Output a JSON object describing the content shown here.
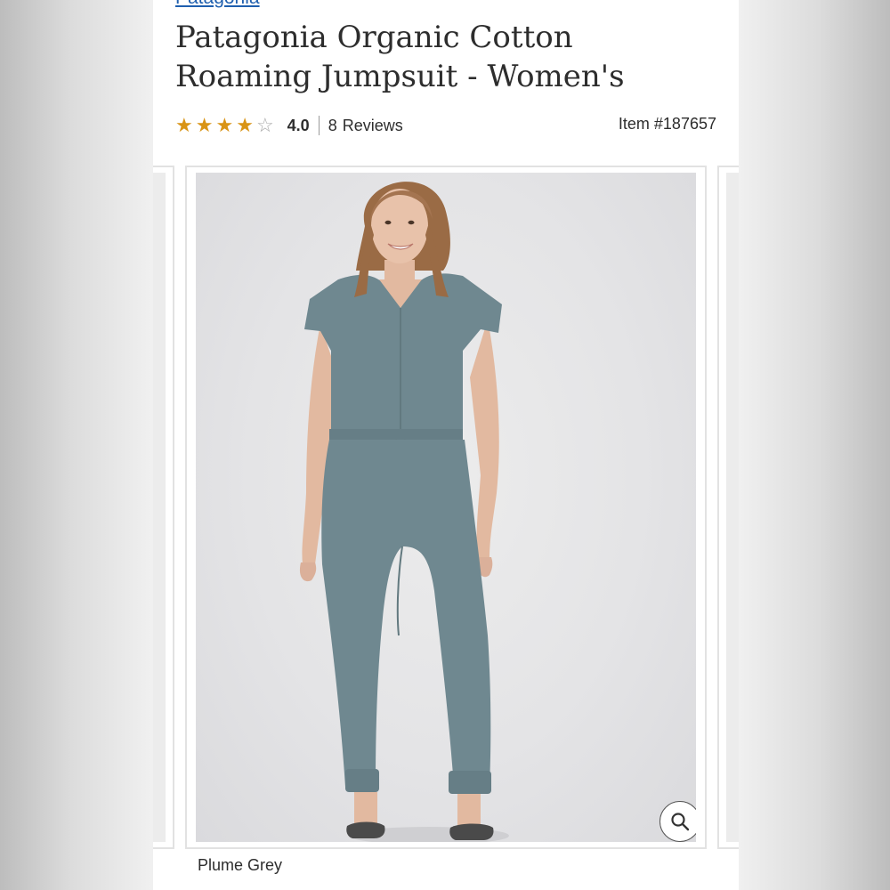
{
  "product": {
    "brand": "Patagonia",
    "title": "Patagonia Organic Cotton Roaming Jumpsuit - Women's",
    "rating": {
      "value": "4.0",
      "stars_filled": 4,
      "stars_total": 5
    },
    "reviews": {
      "count": "8",
      "label": "Reviews"
    },
    "item_number": "Item #187657",
    "selected_color": "Plume Grey"
  },
  "gallery": {
    "image_alt": "Woman wearing a grey-green short-sleeve V-neck jumpsuit with drawstring waist and cuffed ankles",
    "zoom_icon": "magnifier-icon"
  },
  "colors": {
    "link": "#1f5fae",
    "star": "#d99416",
    "text": "#2d2d2d",
    "garment": "#6f8890"
  }
}
